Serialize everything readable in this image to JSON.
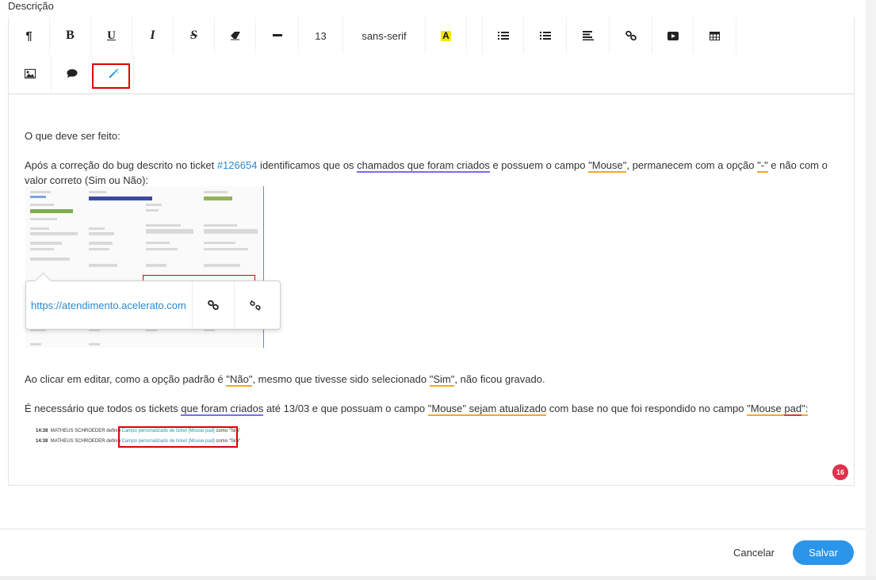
{
  "field_label": "Descrição",
  "toolbar": {
    "font_size": "13",
    "font_family": "sans-serif",
    "icons": [
      "paragraph-icon",
      "bold-icon",
      "underline-icon",
      "italic-icon",
      "strikethrough-icon",
      "eraser-icon",
      "horizontal-rule-icon",
      "text-color-icon",
      "ordered-list-icon",
      "unordered-list-icon",
      "align-left-icon",
      "link-icon",
      "video-icon",
      "table-icon",
      "image-icon",
      "comment-icon",
      "magic-wand-icon"
    ]
  },
  "content": {
    "p1": "O que deve ser feito:",
    "p2_a": "Após a correção do bug descrito no ticket ",
    "p2_link": "#126654",
    "p2_b": " identificamos que os ",
    "p2_u1": "chamados que foram criados",
    "p2_c": " e possuem o campo ",
    "p2_u2": "\"Mouse\"",
    "p2_d": ", permanecem com a opção ",
    "p2_u3": "\"-\"",
    "p2_e": " e não com o valor correto (Sim ou Não):",
    "p3_a": "Ao clicar em editar, como a opção padrão é ",
    "p3_u1": "\"Não\"",
    "p3_b": ", mesmo que tivesse sido selecionado ",
    "p3_u2": "\"Sim\"",
    "p3_c": ", não ficou gravado.",
    "p4_a": "É necessário que todos os tickets ",
    "p4_u1": "que foram criados",
    "p4_b": " até 13/03 e que possuam o campo ",
    "p4_u2": "\"Mouse\" sejam atualizado",
    "p4_c": " com base no que foi respondido no campo ",
    "p4_u3": "\"Mouse ",
    "p4_u4": "pad",
    "p4_d": "\":"
  },
  "link_popover": {
    "url": "https://atendimento.acelerato.com"
  },
  "screenshot2": {
    "line1_time": "14:38",
    "line1_text": "MATHEUS SCHROEDER definiu",
    "line1_field": "Campo personalizado de ticket [Mouse pad]",
    "line1_value": "como \"Sim\"",
    "line2_time": "14:38",
    "line2_text": "MATHEUS SCHROEDER definiu",
    "line2_field": "Campo personalizado de ticket [Mouse pad]",
    "line2_value": "como \"Sim\""
  },
  "badge_count": "16",
  "footer": {
    "cancel_label": "Cancelar",
    "save_label": "Salvar"
  },
  "colors": {
    "primary": "#2b95e9",
    "highlight_red": "#e00000",
    "badge": "#e0304b"
  }
}
